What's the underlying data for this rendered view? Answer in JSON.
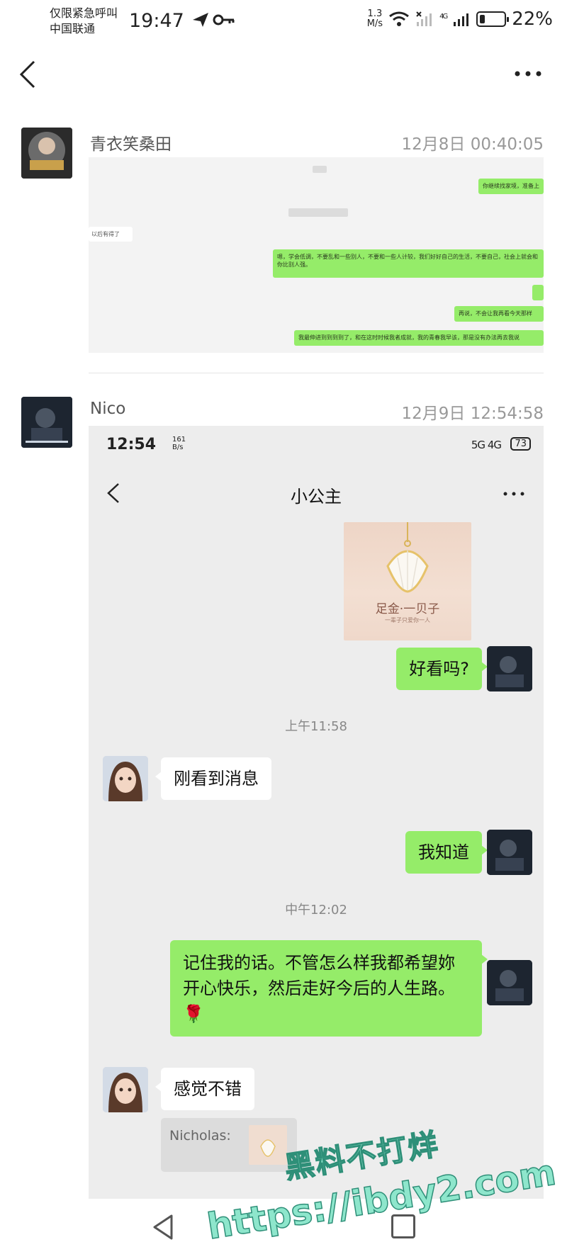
{
  "status_bar": {
    "carrier_line1": "仅限紧急呼叫",
    "carrier_line2": "中国联通",
    "time": "19:47",
    "net_speed_value": "1.3",
    "net_speed_unit": "M/s",
    "signal": "4G",
    "battery_text": "22%",
    "battery_level": 0.22
  },
  "nav": {
    "back_icon": "chevron-left-icon",
    "more_icon": "more-dots-icon"
  },
  "posts": [
    {
      "name": "青衣笑桑田",
      "time": "12月8日 00:40:05",
      "screenshot_lines": [
        "你继续找家境，准备上",
        "以后有得了",
        "嗯，学会低调，不要乱和一些别人，不要和一些人计较，我们好好自己的生活，不要自己，社会上就会和你比别人强。",
        "再说，不会让我再看今天那样",
        "我最伸进到到到到了，和在这时时候我者成就，我的青春我早该，那是没有办法再去我说"
      ]
    },
    {
      "name": "Nico",
      "time": "12月9日 12:54:58",
      "inner": {
        "time": "12:54",
        "speed_value": "161",
        "speed_unit": "B/s",
        "signal": "5G 4G",
        "battery": "73",
        "chat_title": "小公主",
        "product_title": "足金·一贝子",
        "product_subtitle": "一辈子只爱你一人",
        "messages": [
          {
            "side": "right",
            "text": "好看吗?"
          },
          {
            "type": "time",
            "text": "上午11:58"
          },
          {
            "side": "left",
            "text": "刚看到消息"
          },
          {
            "side": "right",
            "text": "我知道"
          },
          {
            "type": "time",
            "text": "中午12:02"
          },
          {
            "side": "right",
            "text": "记住我的话。不管怎么样我都希望妳开心快乐，然后走好今后的人生路。🌹"
          },
          {
            "side": "left",
            "text": "感觉不错"
          }
        ],
        "quote_label": "Nicholas:"
      }
    }
  ],
  "bottom_nav": {
    "back_icon": "triangle-back-icon",
    "home_icon": "square-home-icon"
  },
  "watermark": {
    "line1": "黑料不打烊",
    "line2": "https://ibdy2.com"
  }
}
